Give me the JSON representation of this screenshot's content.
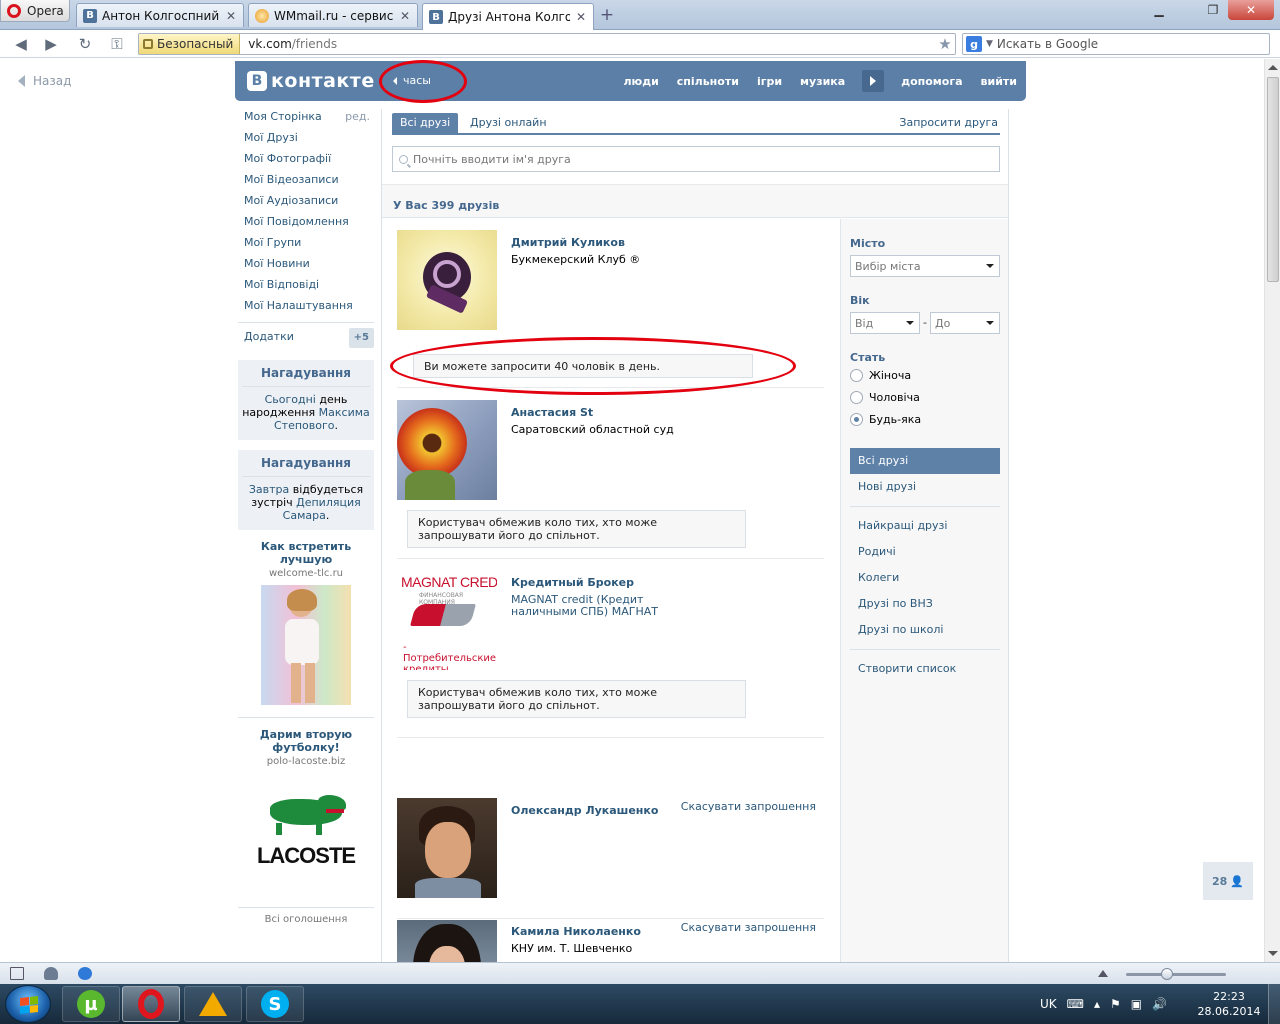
{
  "browser": {
    "opera_label": "Opera",
    "tabs": [
      {
        "title": "Антон Колгоспний"
      },
      {
        "title": "WMmail.ru - сервис п..."
      },
      {
        "title": "Друзі Антона Колгосп..."
      }
    ],
    "secure_label": "Безопасный",
    "url_host": "vk.com",
    "url_path": "/friends",
    "search_placeholder": "Искать в Google"
  },
  "page": {
    "back_label": "Назад",
    "logo_text": "контакте",
    "logo_letter": "В",
    "status_text": "часы",
    "topnav": [
      "люди",
      "спільноти",
      "ігри",
      "музика",
      "допомога",
      "вийти"
    ],
    "left_menu": {
      "items": [
        "Моя Сторінка",
        "Мої Друзі",
        "Мої Фотографії",
        "Мої Відеозаписи",
        "Мої Аудіозаписи",
        "Мої Повідомлення",
        "Мої Групи",
        "Мої Новини",
        "Мої Відповіді",
        "Мої Налаштування"
      ],
      "edit_label": "ред.",
      "apps_label": "Додатки",
      "apps_badge": "+5"
    },
    "reminders": [
      {
        "title": "Нагадування",
        "p1": "Сьогодні",
        "p2": " день народження ",
        "p3": "Максима Степового",
        "p4": "."
      },
      {
        "title": "Нагадування",
        "p1": "Завтра",
        "p2": " відбудеться зустріч ",
        "p3": "Депиляция Самара",
        "p4": "."
      }
    ],
    "ads": [
      {
        "title": "Как встретить лучшую",
        "domain": "welcome-tlc.ru"
      },
      {
        "title": "Дарим вторую футболку!",
        "domain": "polo-lacoste.biz",
        "brand": "LACOSTE"
      }
    ],
    "all_ads_label": "Всі оголошення",
    "tabs": {
      "all": "Всі друзі",
      "online": "Друзі онлайн",
      "invite": "Запросити друга"
    },
    "search_placeholder": "Почніть вводити ім'я друга",
    "friend_count": "У Вас 399 друзів",
    "friends": [
      {
        "name": "Дмитрий Куликов",
        "info": "Букмекерский Клуб ®",
        "note": "Ви можете запросити 40 чоловік в день."
      },
      {
        "name": "Анастасия St",
        "info": "Саратовский областной суд",
        "note": "Користувач обмежив коло тих, хто може запрошувати його до спільнот."
      },
      {
        "name": "Кредитный Брокер",
        "info": "MAGNAT credit (Кредит наличными СПБ) МАГНАТ",
        "note": "Користувач обмежив коло тих, хто може запрошувати його до спільнот.",
        "logo_top": "MAGNAT CREDIT",
        "logo_sub": "ФИНАНСОВАЯ КОМПАНИЯ",
        "logo_caption": "- Потребительские кредиты"
      },
      {
        "name": "Олександр Лукашенко",
        "info": "",
        "cancel": "Скасувати запрошення"
      },
      {
        "name": "Камила Николаенко",
        "info": "КНУ им. Т. Шевченко",
        "cancel": "Скасувати запрошення"
      }
    ],
    "filters": {
      "city_label": "Місто",
      "city_value": "Вибір міста",
      "age_label": "Вік",
      "age_from": "Від",
      "age_to": "До",
      "age_dash": "-",
      "sex_label": "Стать",
      "sex_options": [
        "Жіноча",
        "Чоловіча",
        "Будь-яка"
      ],
      "sex_selected": "Будь-яка",
      "lists_a": [
        "Всі друзі",
        "Нові друзі"
      ],
      "lists_b": [
        "Найкращі друзі",
        "Родичі",
        "Колеги",
        "Друзі по ВНЗ",
        "Друзі по школі"
      ],
      "create_list": "Створити список"
    },
    "im_count": "28"
  },
  "taskbar": {
    "lang": "UK",
    "time": "22:23",
    "date": "28.06.2014"
  },
  "colors": {
    "vk_header": "#5b7fa6",
    "link": "#2b587a",
    "annotation_red": "#e3000f"
  }
}
